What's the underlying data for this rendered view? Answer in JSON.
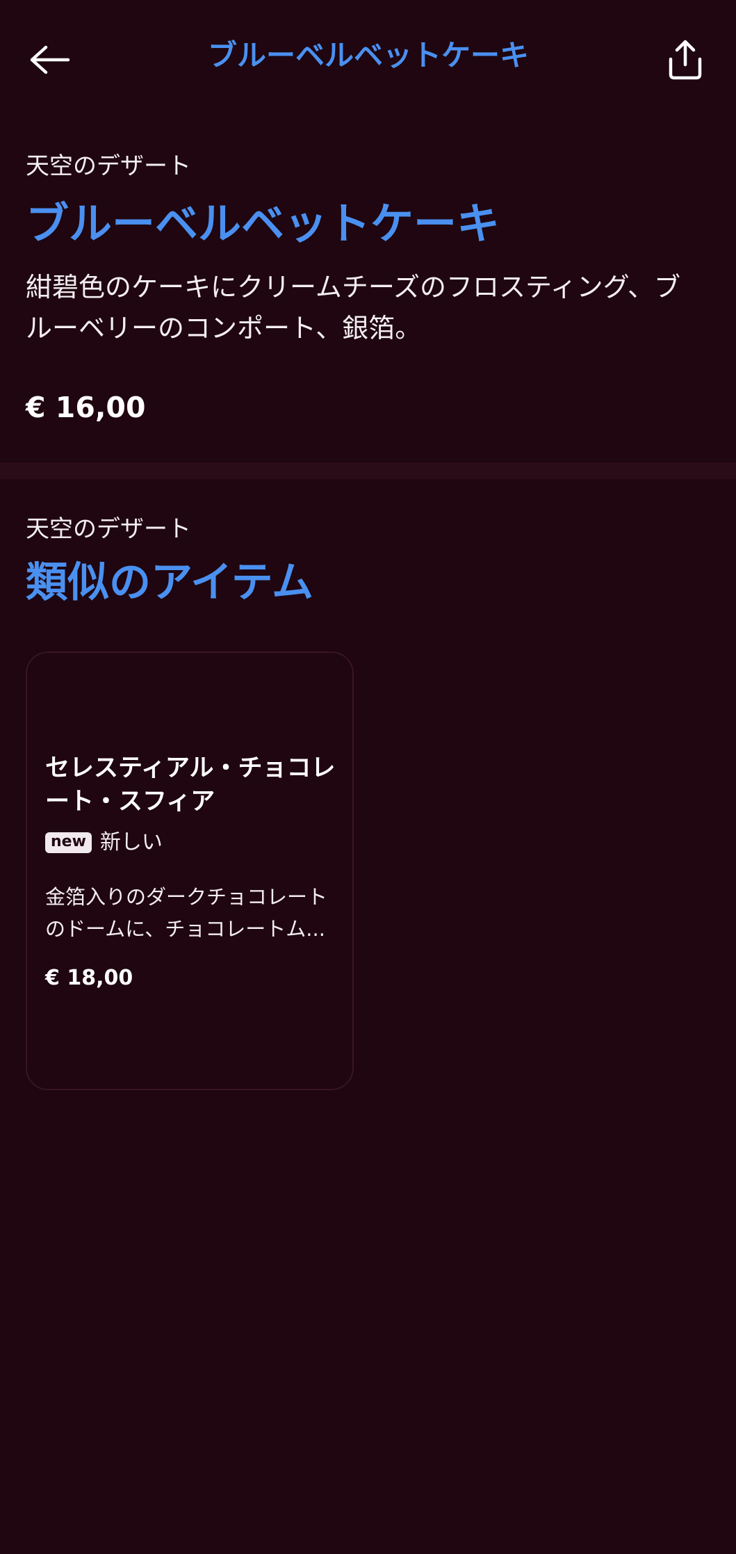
{
  "header": {
    "title": "ブルーベルベットケーキ",
    "back_icon": "arrow-left-icon",
    "share_icon": "share-icon"
  },
  "product": {
    "category": "天空のデザート",
    "title": "ブルーベルベットケーキ",
    "description": "紺碧色のケーキにクリームチーズのフロスティング、ブルーベリーのコンポート、銀箔。",
    "price": "€ 16,00"
  },
  "similar": {
    "category": "天空のデザート",
    "title": "類似のアイテム",
    "items": [
      {
        "title": "セレスティアル・チョコレート・スフィア",
        "badge": "new",
        "badge_label": "新しい",
        "description": "金箔入りのダークチョコレートのドームに、チョコレートム...",
        "price": "€ 18,00"
      }
    ]
  },
  "colors": {
    "background": "#1f0610",
    "accent": "#4a90f0",
    "divider": "#2a0c18",
    "text": "#f4eef1"
  }
}
